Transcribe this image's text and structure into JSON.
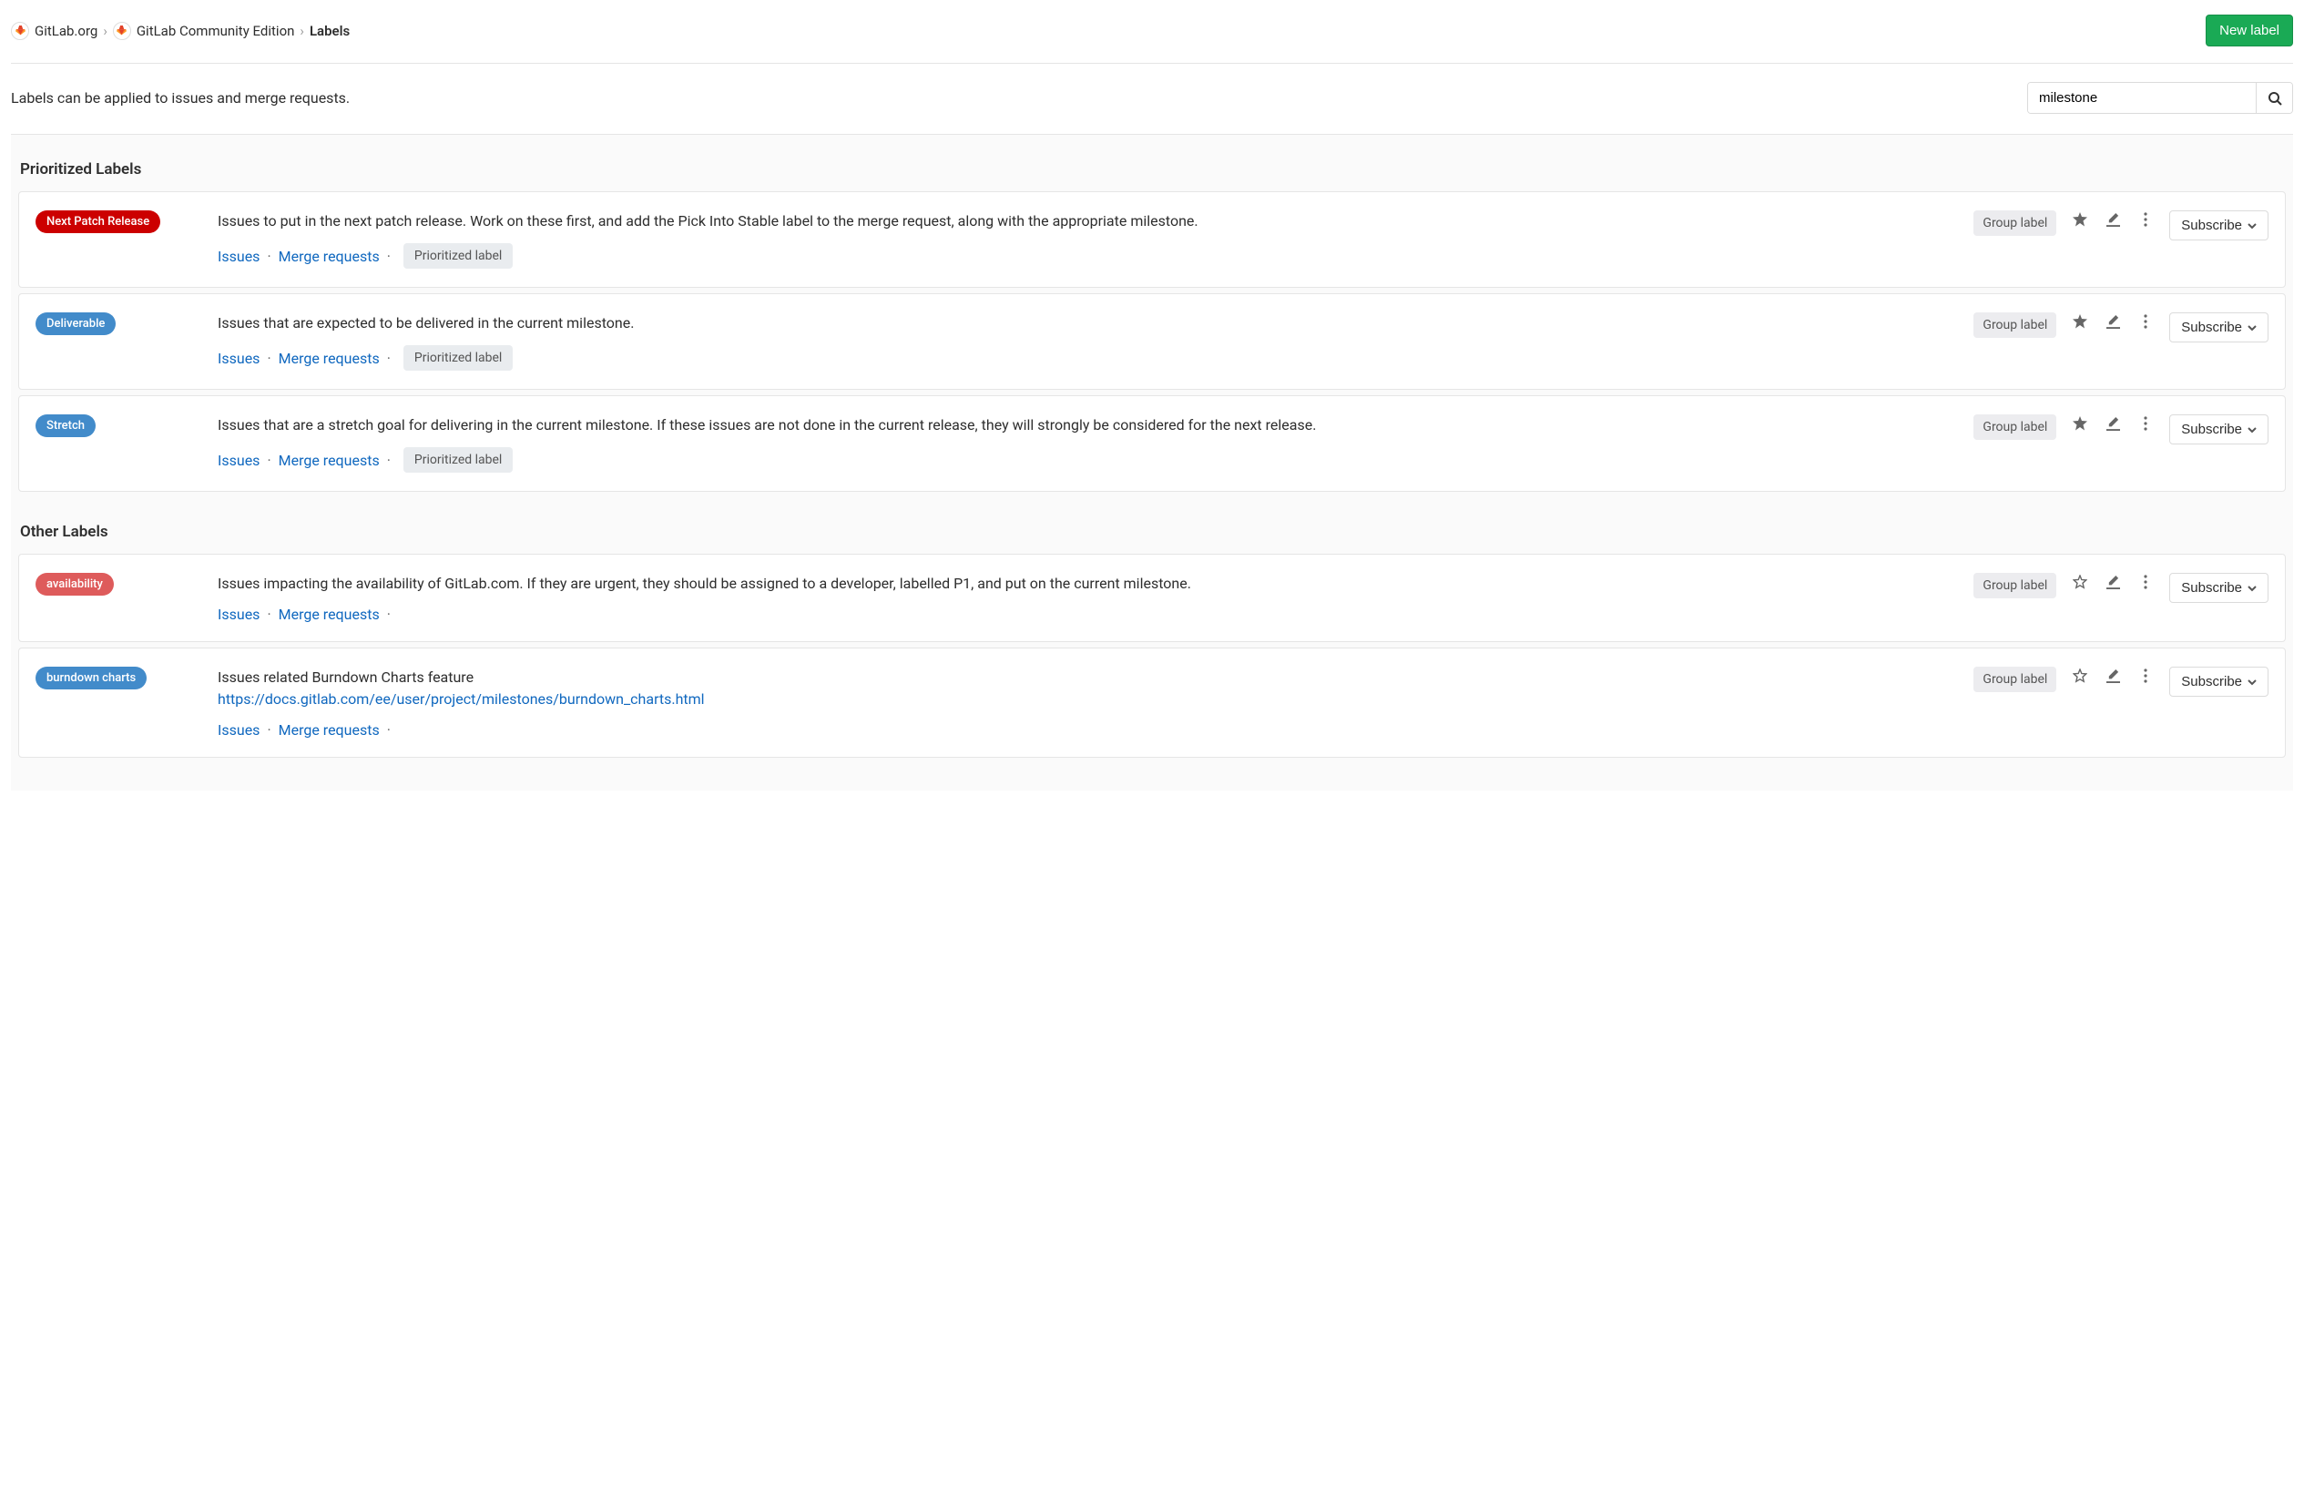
{
  "header": {
    "breadcrumbs": {
      "group": "GitLab.org",
      "project": "GitLab Community Edition",
      "current": "Labels"
    },
    "new_label_btn": "New label"
  },
  "intro": {
    "text": "Labels can be applied to issues and merge requests.",
    "search_value": "milestone"
  },
  "strings": {
    "prioritized_heading": "Prioritized Labels",
    "other_heading": "Other Labels",
    "group_label_badge": "Group label",
    "subscribe": "Subscribe",
    "issues": "Issues",
    "merge_requests": "Merge requests",
    "prioritized_chip": "Prioritized label"
  },
  "prioritized": [
    {
      "name": "Next Patch Release",
      "color": "#cc0000",
      "description": "Issues to put in the next patch release. Work on these first, and add the Pick Into Stable label to the merge request, along with the appropriate milestone.",
      "starred": true
    },
    {
      "name": "Deliverable",
      "color": "#428bca",
      "description": "Issues that are expected to be delivered in the current milestone.",
      "starred": true
    },
    {
      "name": "Stretch",
      "color": "#428bca",
      "description": "Issues that are a stretch goal for delivering in the current milestone. If these issues are not done in the current release, they will strongly be considered for the next release.",
      "starred": true
    }
  ],
  "other": [
    {
      "name": "availability",
      "color": "#de5b5b",
      "description": "Issues impacting the availability of GitLab.com. If they are urgent, they should be assigned to a developer, labelled P1, and put on the current milestone.",
      "starred": false
    },
    {
      "name": "burndown charts",
      "color": "#428bca",
      "description": "Issues related Burndown Charts feature",
      "link_text": "https://docs.gitlab.com/ee/user/project/milestones/burndown_charts.html",
      "starred": false
    }
  ]
}
